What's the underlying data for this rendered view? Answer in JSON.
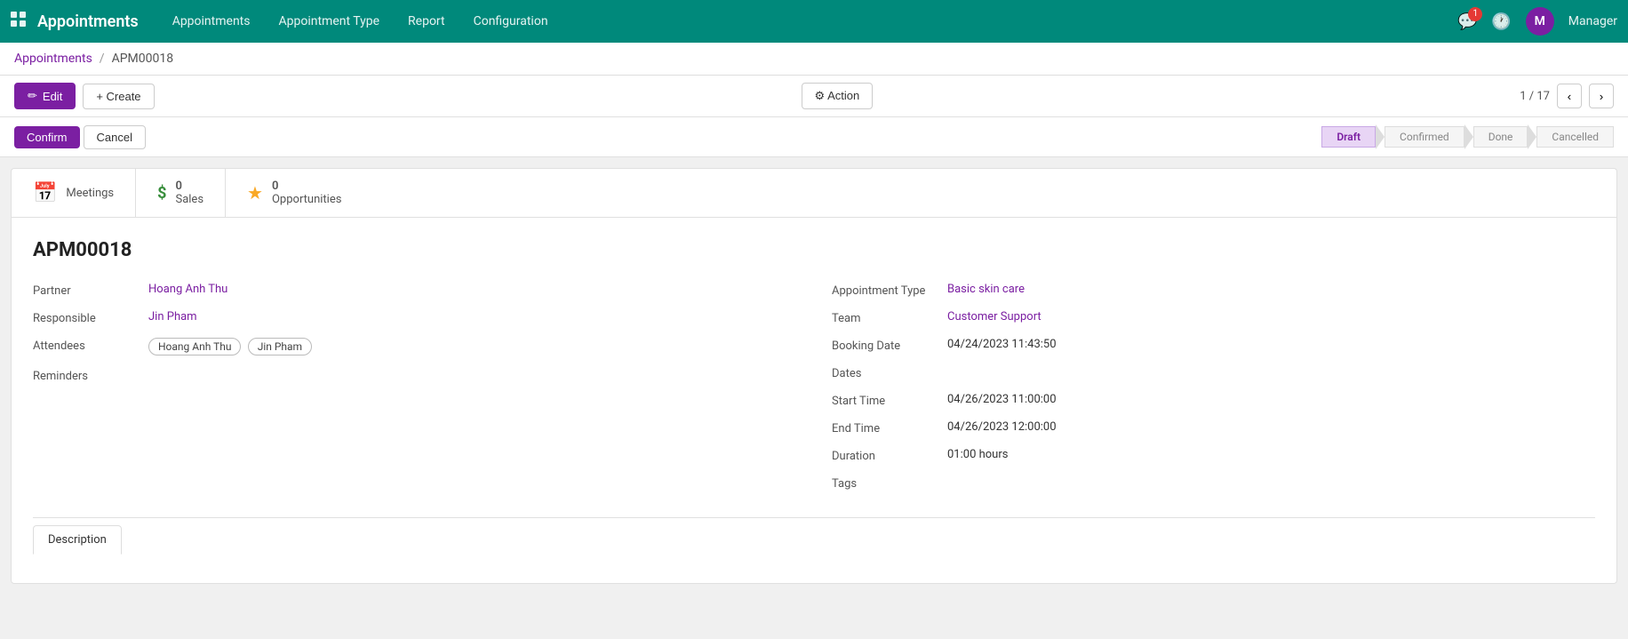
{
  "app": {
    "title": "Appointments",
    "grid_icon": "⊞"
  },
  "nav": {
    "links": [
      {
        "label": "Appointments",
        "id": "nav-appointments"
      },
      {
        "label": "Appointment Type",
        "id": "nav-appointment-type"
      },
      {
        "label": "Report",
        "id": "nav-report"
      },
      {
        "label": "Configuration",
        "id": "nav-configuration"
      }
    ]
  },
  "topbar_right": {
    "notification_count": "1",
    "user_initial": "M",
    "user_name": "Manager"
  },
  "breadcrumb": {
    "parent": "Appointments",
    "separator": "/",
    "current": "APM00018"
  },
  "toolbar": {
    "edit_label": "Edit",
    "create_label": "+ Create",
    "action_label": "⚙ Action"
  },
  "pagination": {
    "current": "1",
    "total": "17"
  },
  "status": {
    "confirm_label": "Confirm",
    "cancel_label": "Cancel",
    "steps": [
      {
        "label": "Draft",
        "active": true
      },
      {
        "label": "Confirmed",
        "active": false
      },
      {
        "label": "Done",
        "active": false
      },
      {
        "label": "Cancelled",
        "active": false
      }
    ]
  },
  "stats": [
    {
      "icon": "📅",
      "icon_class": "purple",
      "label": "Meetings",
      "id": "stat-meetings"
    },
    {
      "icon": "$",
      "icon_class": "green",
      "value": "0",
      "label": "Sales",
      "id": "stat-sales"
    },
    {
      "icon": "★",
      "icon_class": "gold",
      "value": "0",
      "label": "Opportunities",
      "id": "stat-opportunities"
    }
  ],
  "record": {
    "id": "APM00018",
    "fields_left": [
      {
        "label": "Partner",
        "value": "Hoang Anh Thu",
        "type": "link"
      },
      {
        "label": "Responsible",
        "value": "Jin Pham",
        "type": "link"
      },
      {
        "label": "Attendees",
        "value": "",
        "type": "tags",
        "tags": [
          "Hoang Anh Thu",
          "Jin Pham"
        ]
      },
      {
        "label": "Reminders",
        "value": "",
        "type": "plain"
      }
    ],
    "fields_right": [
      {
        "label": "Appointment Type",
        "value": "Basic skin care",
        "type": "link"
      },
      {
        "label": "Team",
        "value": "Customer Support",
        "type": "link"
      },
      {
        "label": "Booking Date",
        "value": "04/24/2023 11:43:50",
        "type": "plain"
      },
      {
        "label": "Dates",
        "value": "",
        "type": "plain"
      },
      {
        "label": "Start Time",
        "value": "04/26/2023 11:00:00",
        "type": "plain"
      },
      {
        "label": "End Time",
        "value": "04/26/2023 12:00:00",
        "type": "plain"
      },
      {
        "label": "Duration",
        "value": "01:00  hours",
        "type": "plain"
      },
      {
        "label": "Tags",
        "value": "",
        "type": "plain"
      }
    ]
  },
  "tabs": [
    {
      "label": "Description",
      "active": true
    }
  ]
}
